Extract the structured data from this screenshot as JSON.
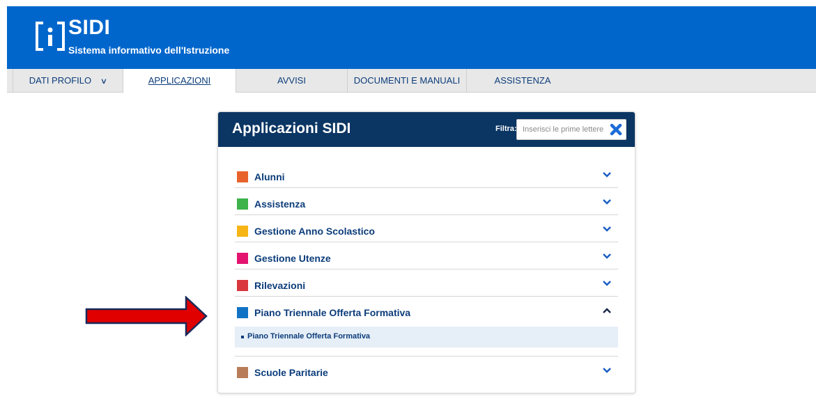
{
  "header": {
    "title": "SIDI",
    "subtitle": "Sistema informativo dell'Istruzione"
  },
  "nav": {
    "items": [
      {
        "label": "DATI PROFILO"
      },
      {
        "label": "APPLICAZIONI"
      },
      {
        "label": "AVVISI"
      },
      {
        "label": "DOCUMENTI E MANUALI"
      },
      {
        "label": "ASSISTENZA"
      }
    ]
  },
  "panel": {
    "title": "Applicazioni SIDI",
    "filter_label": "Filtra:",
    "filter_placeholder": "Inserisci le prime lettere",
    "categories": [
      {
        "label": "Alunni",
        "color": "#e8632b",
        "expanded": false
      },
      {
        "label": "Assistenza",
        "color": "#3db34a",
        "expanded": false
      },
      {
        "label": "Gestione Anno Scolastico",
        "color": "#f7b515",
        "expanded": false
      },
      {
        "label": "Gestione Utenze",
        "color": "#e3136f",
        "expanded": false
      },
      {
        "label": "Rilevazioni",
        "color": "#d9363e",
        "expanded": false
      },
      {
        "label": "Piano Triennale Offerta Formativa",
        "color": "#1273c4",
        "expanded": true
      },
      {
        "label": "Scuole Paritarie",
        "color": "#b87c58",
        "expanded": false
      }
    ],
    "sub_items": [
      {
        "label": "Piano Triennale Offerta Formativa"
      }
    ]
  },
  "colors": {
    "header_bg": "#0066cc",
    "panel_head_bg": "#0b3563",
    "link": "#0b3c7a",
    "arrow": "#e00000"
  },
  "icons": [
    "sidi-logo-icon",
    "chevron-down-icon",
    "chevron-up-icon",
    "close-icon",
    "red-arrow"
  ]
}
